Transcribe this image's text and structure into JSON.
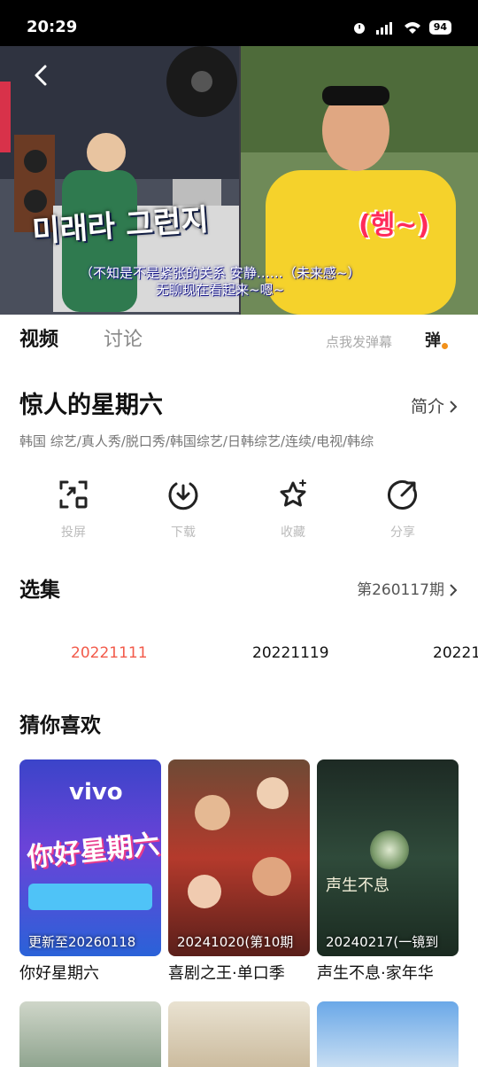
{
  "status_bar": {
    "time": "20:29",
    "battery": "94"
  },
  "video": {
    "subtitle_kr": "미래라 그런지",
    "subtitle_cn_line1": "（不知是不是紧张的关系 安静……（未来感~）",
    "subtitle_cn_line2": "无聊现在看起来~嗯~",
    "subtitle_right": "(헹~)"
  },
  "tabs": {
    "video": "视频",
    "discuss": "讨论"
  },
  "danmaku": {
    "placeholder": "点我发弹幕",
    "icon_label": "弹"
  },
  "show": {
    "title": "惊人的星期六",
    "intro_label": "简介",
    "tags": "韩国  综艺/真人秀/脱口秀/韩国综艺/日韩综艺/连续/电视/韩综"
  },
  "actions": [
    {
      "label": "投屏"
    },
    {
      "label": "下载"
    },
    {
      "label": "收藏"
    },
    {
      "label": "分享"
    }
  ],
  "episodes_section": {
    "title": "选集",
    "latest": "第260117期",
    "items": [
      "20221111",
      "20221119",
      "20221"
    ]
  },
  "recommend": {
    "title": "猜你喜欢",
    "cards": [
      {
        "caption": "更新至20260118",
        "title": "你好星期六",
        "poster_text": "你好星期六",
        "brand": "vivo"
      },
      {
        "caption": "20241020(第10期",
        "title": "喜剧之王·单口季"
      },
      {
        "caption": "20240217(一镜到",
        "title": "声生不息·家年华",
        "poster_text": "声生不息"
      }
    ]
  },
  "colors": {
    "accent": "#f25a4a",
    "badge": "#f2911b"
  }
}
